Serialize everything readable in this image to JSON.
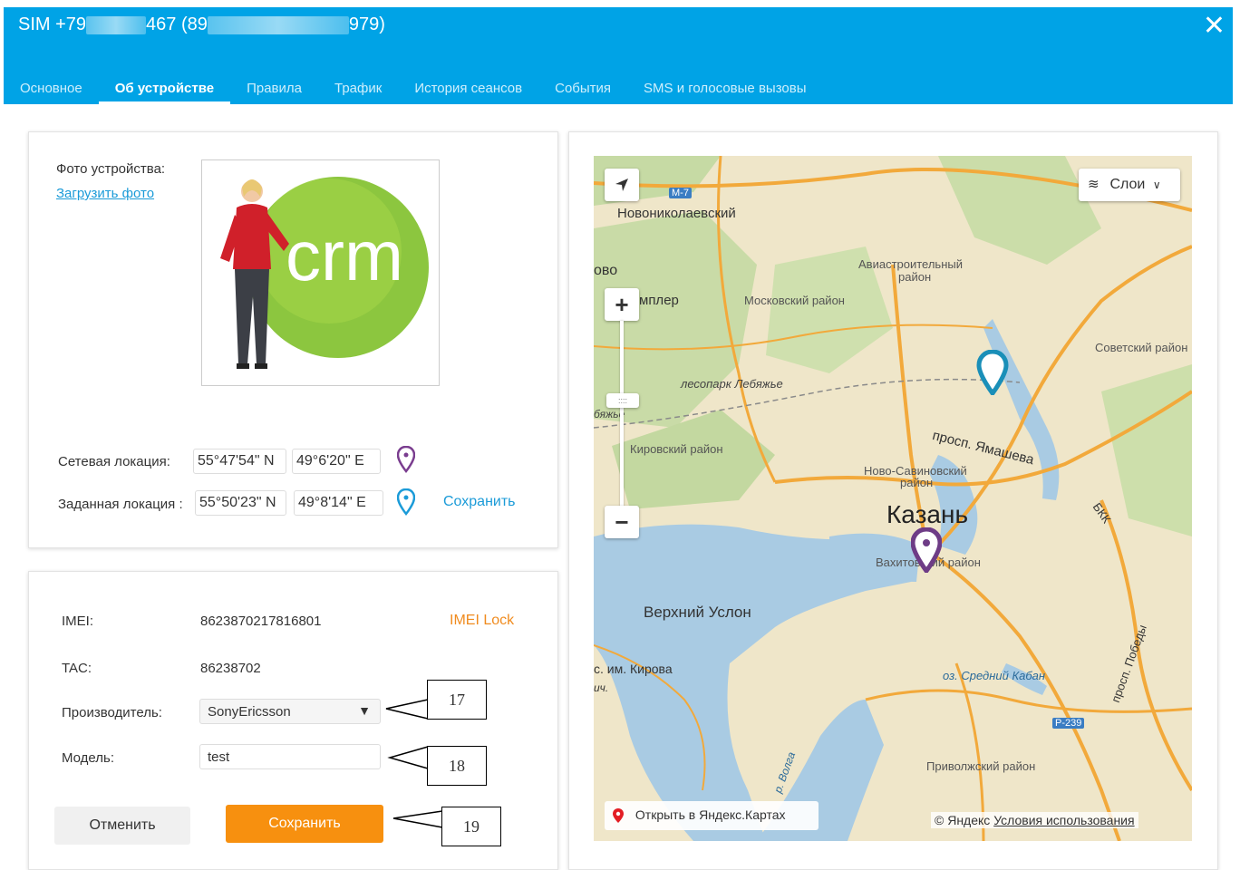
{
  "header": {
    "title_prefix": "SIM +79",
    "title_mid": "467 (89",
    "title_suffix": "979)",
    "close": "✕",
    "bg_color": "#00a3e6"
  },
  "tabs": [
    {
      "label": "Основное",
      "active": false
    },
    {
      "label": "Об устройстве",
      "active": true
    },
    {
      "label": "Правила",
      "active": false
    },
    {
      "label": "Трафик",
      "active": false
    },
    {
      "label": "История сеансов",
      "active": false
    },
    {
      "label": "События",
      "active": false
    },
    {
      "label": "SMS и голосовые вызовы",
      "active": false
    }
  ],
  "device": {
    "photo_label": "Фото устройства:",
    "upload_link": "Загрузить фото",
    "photo_logo_text": "crm",
    "network_location_label": "Сетевая локация:",
    "network_lat": "55°47'54\" N",
    "network_lon": "49°6'20\" E",
    "set_location_label": "Заданная локация :",
    "set_lat": "55°50'23\" N",
    "set_lon": "49°8'14\" E",
    "save_location": "Сохранить"
  },
  "info": {
    "imei_label": "IMEI:",
    "imei_value": "8623870217816801",
    "imei_lock": "IMEI Lock",
    "tac_label": "TAC:",
    "tac_value": "86238702",
    "manufacturer_label": "Производитель:",
    "manufacturer_value": "SonyEricsson",
    "model_label": "Модель:",
    "model_value": "test",
    "cancel_button": "Отменить",
    "save_button": "Сохранить",
    "accent_color": "#f7900f"
  },
  "callouts": [
    "17",
    "18",
    "19"
  ],
  "map": {
    "layers_button": "Слои",
    "open_yandex": "Открыть в Яндекс.Картах",
    "copyright_brand": "© Яндекс",
    "copyright_link": "Условия использования",
    "labels": {
      "novonikolaevsky": "Новониколаевский",
      "ovo": "ово",
      "mpler": "мплер",
      "moskovsky": "Московский район",
      "aviastroitelny_1": "Авиастроительный",
      "aviastroitelny_2": "район",
      "sovetsky": "Советский район",
      "lesopark": "лесопарк Лебяжье",
      "bjazhye": "бяжье",
      "yamasheva": "просп. Ямашева",
      "kirovsky": "Кировский район",
      "novo_savinovsky_1": "Ново-Савиновский",
      "novo_savinovsky_2": "район",
      "bkk": "БКК",
      "kazan": "Казань",
      "vakhitovsky": "Вахитовский район",
      "verkhny_uslon": "Верхний Услон",
      "s_im_kirova": "с. им. Кирова",
      "ich": "ич.",
      "sredny_kaban": "оз. Средний Кабан",
      "pobedy": "просп. Победы",
      "privolzhsky": "Приволжский район",
      "volga": "р. Волга",
      "m7": "М-7",
      "r239": "Р-239"
    }
  }
}
